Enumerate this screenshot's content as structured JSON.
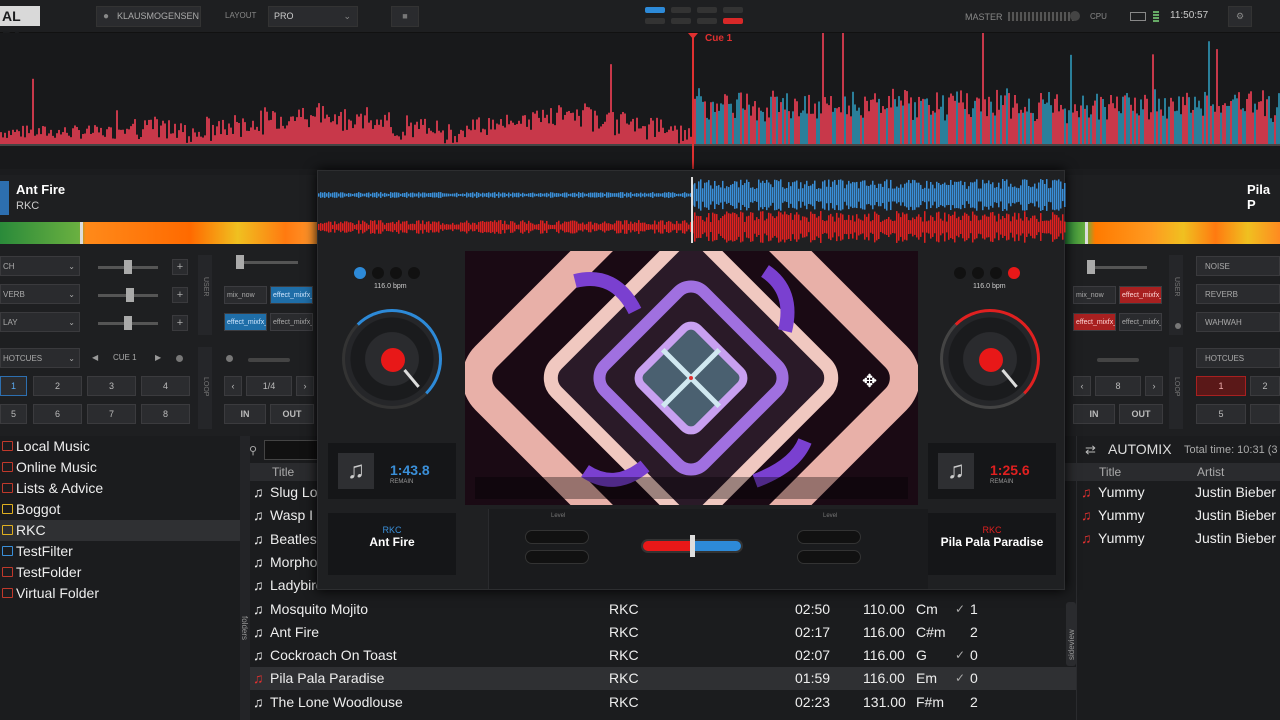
{
  "app": {
    "logo": "AL DJ"
  },
  "topbar": {
    "user": "KLAUSMOGENSEN",
    "layout_label": "LAYOUT",
    "layout_value": "PRO",
    "master_label": "MASTER",
    "cpu_label": "CPU",
    "clock": "11:50:57"
  },
  "overview": {
    "cue_label": "Cue 1"
  },
  "deck_left": {
    "title": "Ant Fire",
    "artist": "RKC",
    "fx": [
      "CH",
      "VERB",
      "LAY"
    ],
    "sampler": [
      "mix_now",
      "effect_mixfx_",
      "effect_mixfx_",
      "effect_mixfx_"
    ],
    "hotcues_label": "HOTCUES",
    "cue_label": "CUE 1",
    "pads": [
      "1",
      "2",
      "3",
      "4",
      "5",
      "6",
      "7",
      "8"
    ],
    "loop_size": "1/4",
    "in_label": "IN",
    "out_label": "OUT",
    "user_label": "USER",
    "loop_label": "LOOP"
  },
  "deck_right": {
    "title": "Pila P",
    "fx": [
      "NOISE",
      "REVERB",
      "WAHWAH"
    ],
    "sampler": [
      "mix_now",
      "effect_mixfx_",
      "effect_mixfx_",
      "effect_mixfx_"
    ],
    "hotcues_label": "HOTCUES",
    "pads": [
      "1",
      "2",
      "5"
    ],
    "loop_size": "8",
    "in_label": "IN",
    "out_label": "OUT",
    "user_label": "USER",
    "loop_label": "LOOP"
  },
  "center": {
    "left": {
      "bpm": "116.0 bpm",
      "time": "1:43.8",
      "remain": "REMAIN",
      "artist": "RKC",
      "title": "Ant Fire"
    },
    "right": {
      "bpm": "116.0 bpm",
      "time": "1:25.6",
      "remain": "REMAIN",
      "artist": "RKC",
      "title": "Pila Pala Paradise"
    },
    "level_label": "Level",
    "crossfader_position": 0.5
  },
  "folders": [
    {
      "label": "Local Music",
      "color": "#c0392b"
    },
    {
      "label": "Online Music",
      "color": "#c0392b"
    },
    {
      "label": "Lists & Advice",
      "color": "#c0392b"
    },
    {
      "label": "Boggot",
      "color": "#e0b020"
    },
    {
      "label": "RKC",
      "color": "#e0b020",
      "selected": true
    },
    {
      "label": "TestFilter",
      "color": "#3a8fd8"
    },
    {
      "label": "TestFolder",
      "color": "#c0392b"
    },
    {
      "label": "Virtual Folder",
      "color": "#c0392b"
    }
  ],
  "browser": {
    "column_title": "Title",
    "side_left": "folders",
    "side_right": "sideview",
    "tracks_partial": [
      "Slug Lo",
      "Wasp I",
      "Beatles",
      "Morpho",
      "Ladybirds Mute"
    ],
    "tracks": [
      {
        "title": "Mosquito Mojito",
        "artist": "RKC",
        "length": "02:50",
        "bpm": "110.00",
        "key": "Cm",
        "plays": "1",
        "check": true
      },
      {
        "title": "Ant Fire",
        "artist": "RKC",
        "length": "02:17",
        "bpm": "116.00",
        "key": "C#m",
        "plays": "2",
        "check": false
      },
      {
        "title": "Cockroach On Toast",
        "artist": "RKC",
        "length": "02:07",
        "bpm": "116.00",
        "key": "G",
        "plays": "0",
        "check": true
      },
      {
        "title": "Pila Pala Paradise",
        "artist": "RKC",
        "length": "01:59",
        "bpm": "116.00",
        "key": "Em",
        "plays": "0",
        "check": true,
        "selected": true
      },
      {
        "title": "The Lone Woodlouse",
        "artist": "RKC",
        "length": "02:23",
        "bpm": "131.00",
        "key": "F#m",
        "plays": "2",
        "check": false
      }
    ]
  },
  "automix": {
    "title": "AUTOMIX",
    "total": "Total time: 10:31 (3",
    "col_title": "Title",
    "col_artist": "Artist",
    "rows": [
      {
        "title": "Yummy",
        "artist": "Justin Bieber"
      },
      {
        "title": "Yummy",
        "artist": "Justin Bieber"
      },
      {
        "title": "Yummy",
        "artist": "Justin Bieber"
      }
    ]
  },
  "colors": {
    "left_deck": "#3a8fd8",
    "right_deck": "#e02020",
    "accent_red": "#e03030"
  }
}
